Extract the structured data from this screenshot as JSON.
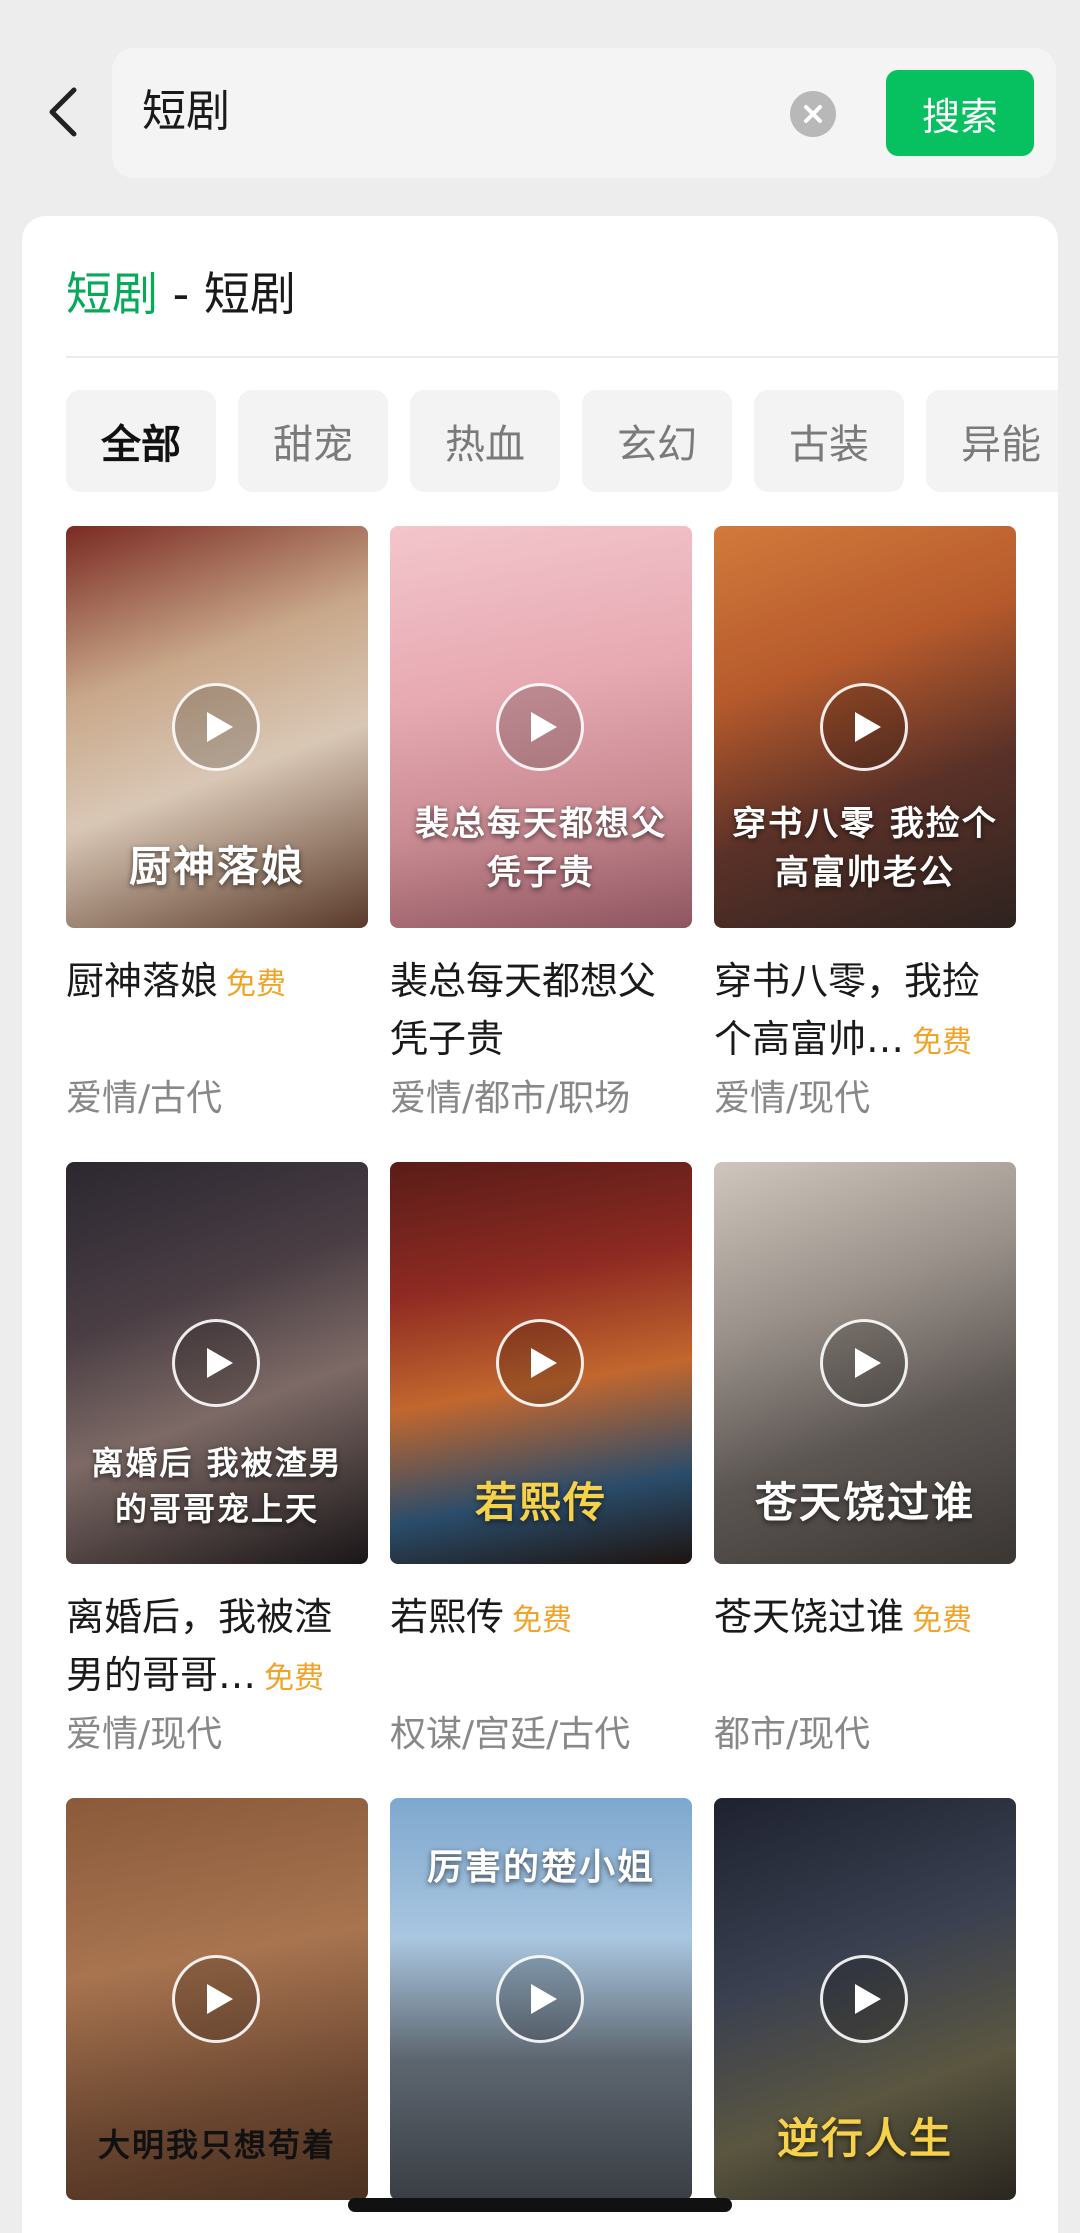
{
  "search": {
    "query": "短剧",
    "button_label": "搜索"
  },
  "section": {
    "title_accent": "短剧",
    "title_sep": " - ",
    "title_rest": "短剧"
  },
  "tabs": [
    "全部",
    "甜宠",
    "热血",
    "玄幻",
    "古装",
    "异能"
  ],
  "colors": {
    "accent": "#07c160",
    "free_badge": "#f0a328"
  },
  "free_label": "免费",
  "dramas": [
    {
      "title": "厨神落娘",
      "free": true,
      "genre": "爱情/古代",
      "poster_text": "厨神落娘"
    },
    {
      "title": "裴总每天都想父凭子贵",
      "free": false,
      "genre": "爱情/都市/职场",
      "poster_text": "裴总每天都想父凭子贵"
    },
    {
      "title": "穿书八零，我捡个高富帅…",
      "free": true,
      "genre": "爱情/现代",
      "poster_text": "穿书八零 我捡个高富帅老公"
    },
    {
      "title": "离婚后，我被渣男的哥哥…",
      "free": true,
      "genre": "爱情/现代",
      "poster_text": "离婚后 我被渣男的哥哥宠上天"
    },
    {
      "title": "若熙传",
      "free": true,
      "genre": "权谋/宫廷/古代",
      "poster_text": "若熙传"
    },
    {
      "title": "苍天饶过谁",
      "free": true,
      "genre": "都市/现代",
      "poster_text": "苍天饶过谁"
    },
    {
      "poster_text": "大明我只想苟着"
    },
    {
      "poster_text": "厉害的楚小姐"
    },
    {
      "poster_text": "逆行人生"
    }
  ]
}
